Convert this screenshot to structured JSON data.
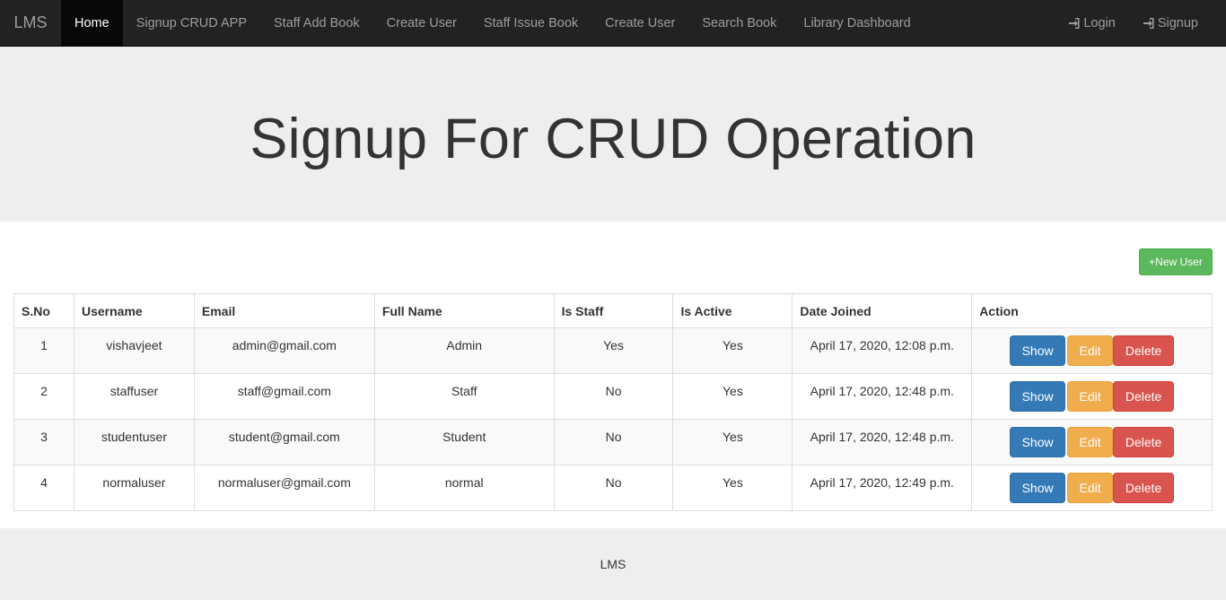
{
  "navbar": {
    "brand": "LMS",
    "items": [
      {
        "label": "Home"
      },
      {
        "label": "Signup CRUD APP"
      },
      {
        "label": "Staff Add Book"
      },
      {
        "label": "Create User"
      },
      {
        "label": "Staff Issue Book"
      },
      {
        "label": "Create User"
      },
      {
        "label": "Search Book"
      },
      {
        "label": "Library Dashboard"
      }
    ],
    "right": {
      "login_label": "Login",
      "signup_label": "Signup",
      "login_icon": "log-in-icon",
      "signup_icon": "log-in-icon"
    }
  },
  "jumbotron": {
    "title": "Signup For CRUD Operation"
  },
  "new_user_button": "+New User",
  "table": {
    "headers": [
      "S.No",
      "Username",
      "Email",
      "Full Name",
      "Is Staff",
      "Is Active",
      "Date Joined",
      "Action"
    ],
    "rows": [
      {
        "sno": "1",
        "username": "vishavjeet",
        "email": "admin@gmail.com",
        "full_name": "Admin",
        "is_staff": "Yes",
        "is_active": "Yes",
        "date_joined": "April 17, 2020, 12:08 p.m."
      },
      {
        "sno": "2",
        "username": "staffuser",
        "email": "staff@gmail.com",
        "full_name": "Staff",
        "is_staff": "No",
        "is_active": "Yes",
        "date_joined": "April 17, 2020, 12:48 p.m."
      },
      {
        "sno": "3",
        "username": "studentuser",
        "email": "student@gmail.com",
        "full_name": "Student",
        "is_staff": "No",
        "is_active": "Yes",
        "date_joined": "April 17, 2020, 12:48 p.m."
      },
      {
        "sno": "4",
        "username": "normaluser",
        "email": "normaluser@gmail.com",
        "full_name": "normal",
        "is_staff": "No",
        "is_active": "Yes",
        "date_joined": "April 17, 2020, 12:49 p.m."
      }
    ],
    "actions": {
      "show": "Show",
      "edit": "Edit",
      "delete": "Delete"
    }
  },
  "footer": {
    "text": "LMS"
  },
  "colors": {
    "navbar_bg": "#222222",
    "jumbotron_bg": "#eeeeee",
    "success": "#5cb85c",
    "primary": "#337ab7",
    "warning": "#f0ad4e",
    "danger": "#d9534f"
  }
}
